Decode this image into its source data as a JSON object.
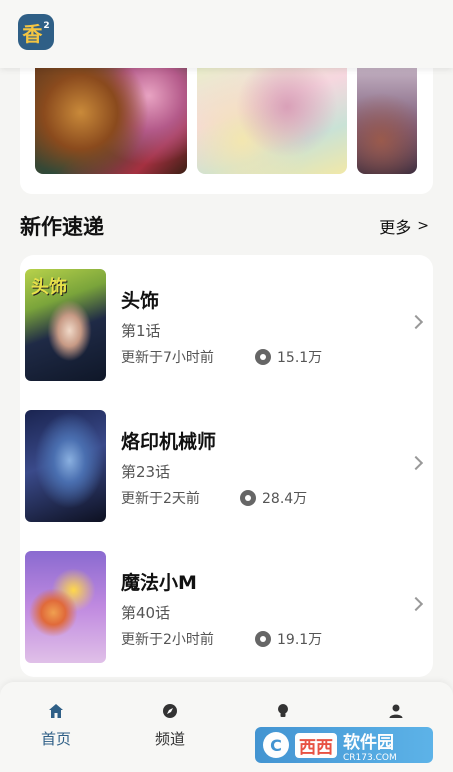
{
  "header": {
    "logo_text": "香",
    "logo_sup": "2"
  },
  "section": {
    "title": "新作速递",
    "more_label": "更多",
    "more_chevron": ">"
  },
  "items": [
    {
      "cover_text": "头饰",
      "title": "头饰",
      "chapter": "第1话",
      "updated": "更新于7小时前",
      "views": "15.1万"
    },
    {
      "cover_text": "",
      "title": "烙印机械师",
      "chapter": "第23话",
      "updated": "更新于2天前",
      "views": "28.4万"
    },
    {
      "cover_text": "",
      "title": "魔法小M",
      "chapter": "第40话",
      "updated": "更新于2小时前",
      "views": "19.1万"
    }
  ],
  "nav": [
    {
      "label": "首页",
      "icon": "home-icon",
      "active": true
    },
    {
      "label": "频道",
      "icon": "compass-icon",
      "active": false
    },
    {
      "label": "",
      "icon": "bulb-icon",
      "active": false
    },
    {
      "label": "",
      "icon": "user-icon",
      "active": false
    }
  ],
  "watermark": {
    "brand": "西西",
    "text": "软件园",
    "sub": "CR173.COM"
  },
  "colors": {
    "accent": "#2f5f86",
    "background": "#f5f5f3",
    "card": "#ffffff"
  }
}
